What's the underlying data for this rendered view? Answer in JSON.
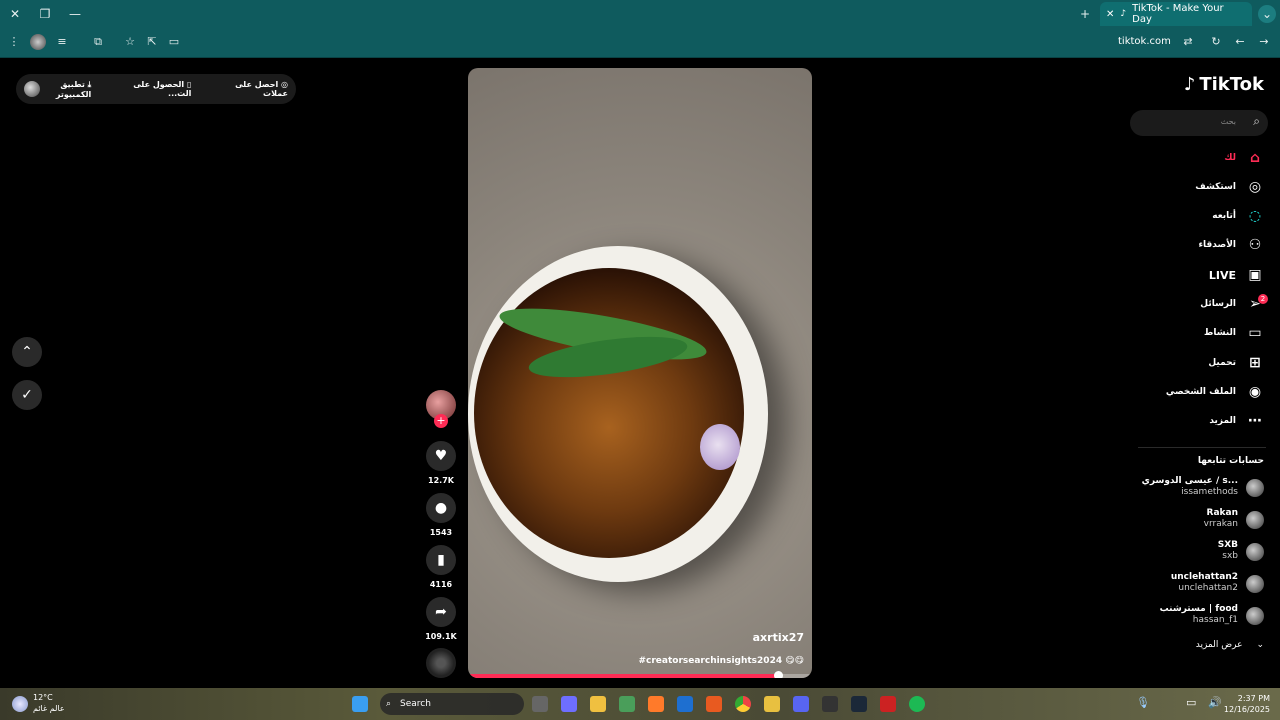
{
  "browser": {
    "tab_title": "TikTok - Make Your Day",
    "url": "tiktok.com"
  },
  "promo_bar": {
    "get_coins": "احصل على عملات",
    "get_app": "الحصول على الت...",
    "desktop_app": "تطبيق الكمبيوتر"
  },
  "video": {
    "username": "axrtix27",
    "caption": "#creatorsearchinsights2024 😋😋",
    "progress": 0.9
  },
  "actions": {
    "likes": "12.7K",
    "comments": "1543",
    "saves": "4116",
    "shares": "109.1K"
  },
  "sidebar": {
    "logo": "TikTok",
    "search_placeholder": "بحث",
    "nav": [
      {
        "label": "لك",
        "icon": "home-icon"
      },
      {
        "label": "استكشف",
        "icon": "compass-icon"
      },
      {
        "label": "أتابعه",
        "icon": "following-icon"
      },
      {
        "label": "الأصدقاء",
        "icon": "friends-icon"
      },
      {
        "label": "LIVE",
        "icon": "live-icon"
      },
      {
        "label": "الرسائل",
        "icon": "send-icon"
      },
      {
        "label": "النشاط",
        "icon": "activity-icon"
      },
      {
        "label": "تحميل",
        "icon": "upload-icon"
      },
      {
        "label": "الملف الشخصي",
        "icon": "profile-icon"
      },
      {
        "label": "المزيد",
        "icon": "more-icon"
      }
    ],
    "messages_badge": "2",
    "following_title": "حسابات تتابعها",
    "accounts": [
      {
        "name": "عيسى الدوسري / s...",
        "handle": "issamethods"
      },
      {
        "name": "Rakan",
        "handle": "vrrakan"
      },
      {
        "name": "SXB",
        "handle": "sxb"
      },
      {
        "name": "unclehattan2",
        "handle": "unclehattan2"
      },
      {
        "name": "مسترشنب | food",
        "handle": "hassan_f1"
      }
    ],
    "see_more": "عرض المزيد"
  },
  "taskbar": {
    "temperature": "12°C",
    "weather_desc": "عالم غائم",
    "search": "Search",
    "time": "2:37 PM",
    "date": "12/16/2025"
  }
}
